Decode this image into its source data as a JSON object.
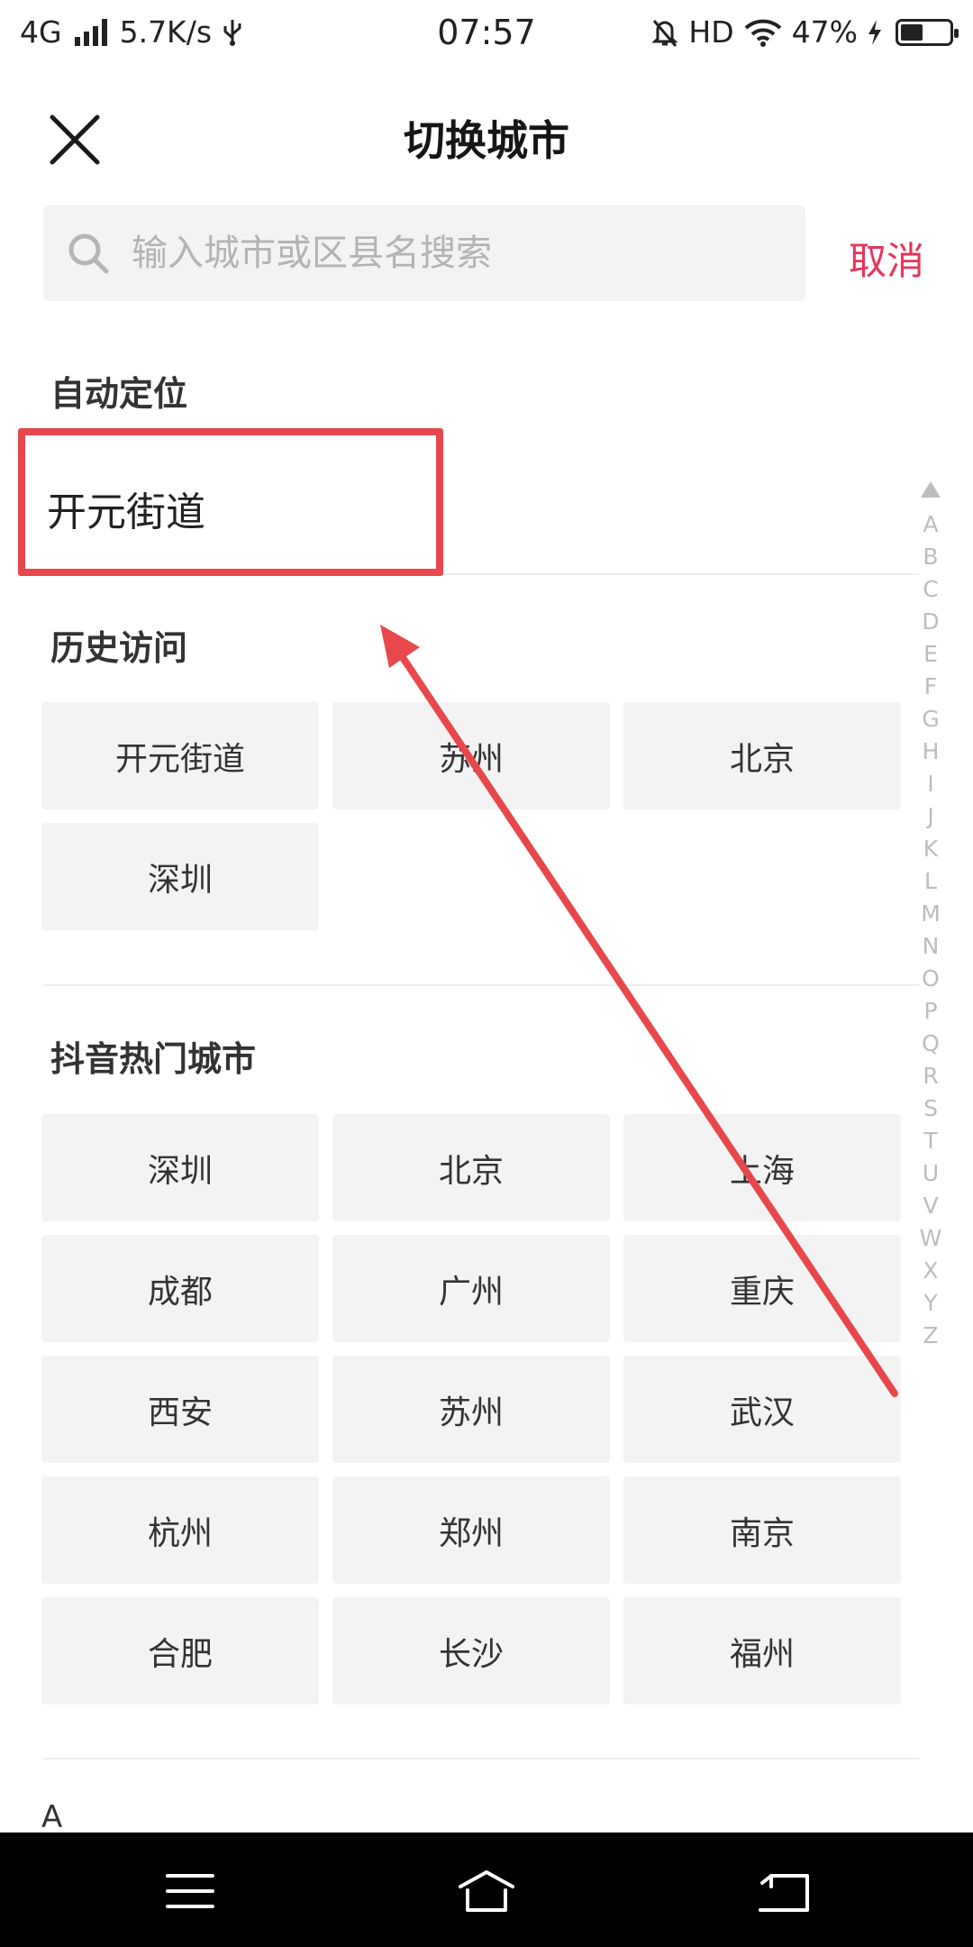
{
  "status_bar": {
    "network": "4G",
    "speed": "5.7K/s",
    "time": "07:57",
    "hd": "HD",
    "battery": "47%",
    "battery_level": 0.47
  },
  "header": {
    "title": "切换城市"
  },
  "search": {
    "placeholder": "输入城市或区县名搜索",
    "value": "",
    "cancel_label": "取消"
  },
  "auto_location": {
    "title": "自动定位",
    "location": "开元街道"
  },
  "history": {
    "title": "历史访问",
    "cities": [
      "开元街道",
      "苏州",
      "北京",
      "深圳"
    ]
  },
  "hot": {
    "title": "抖音热门城市",
    "cities": [
      "深圳",
      "北京",
      "上海",
      "成都",
      "广州",
      "重庆",
      "西安",
      "苏州",
      "武汉",
      "杭州",
      "郑州",
      "南京",
      "合肥",
      "长沙",
      "福州"
    ]
  },
  "list_header": "A",
  "index": [
    "A",
    "B",
    "C",
    "D",
    "E",
    "F",
    "G",
    "H",
    "I",
    "J",
    "K",
    "L",
    "M",
    "N",
    "O",
    "P",
    "Q",
    "R",
    "S",
    "T",
    "U",
    "V",
    "W",
    "X",
    "Y",
    "Z"
  ],
  "colors": {
    "accent": "#e9345a",
    "annotation": "#e8484c",
    "chip_bg": "#f3f3f3"
  }
}
